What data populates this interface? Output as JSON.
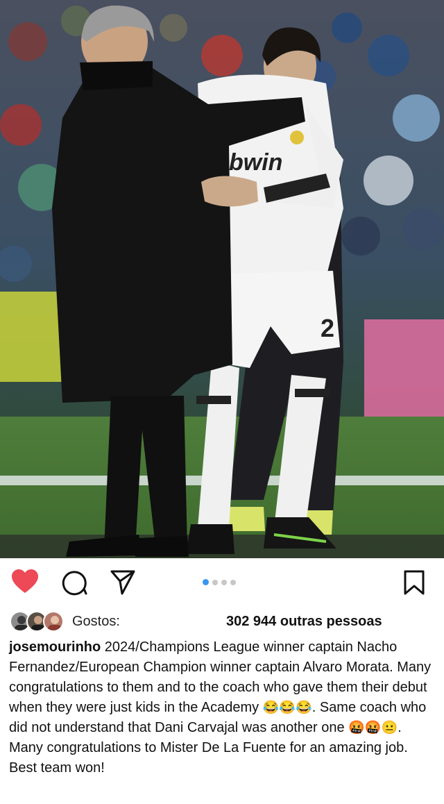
{
  "post": {
    "photo_alt": "photo"
  },
  "actions": {
    "like_icon": "heart-icon",
    "comment_icon": "comment-icon",
    "share_icon": "paper-plane-icon",
    "save_icon": "bookmark-icon",
    "like_color": "#ed4956",
    "carousel": {
      "count": 4,
      "active": 1,
      "active_color": "#3897f0"
    }
  },
  "likes": {
    "label": "Gostos:",
    "others": "302 944 outras pessoas"
  },
  "caption": {
    "username": "josemourinho",
    "text_1": " 2024/Champions League winner captain Nacho Fernandez/European Champion winner captain Alvaro Morata. Many congratulations to them and to the coach who gave them their debut when they were just kids in the Academy ",
    "emoji_1": "😂😂😂",
    "text_2": ". Same coach who did not understand that Dani Carvajal was another one ",
    "emoji_2": "🤬🤬😐",
    "text_3": ".",
    "text_4": "Many congratulations to Mister De La Fuente for an amazing job. Best team won!"
  }
}
